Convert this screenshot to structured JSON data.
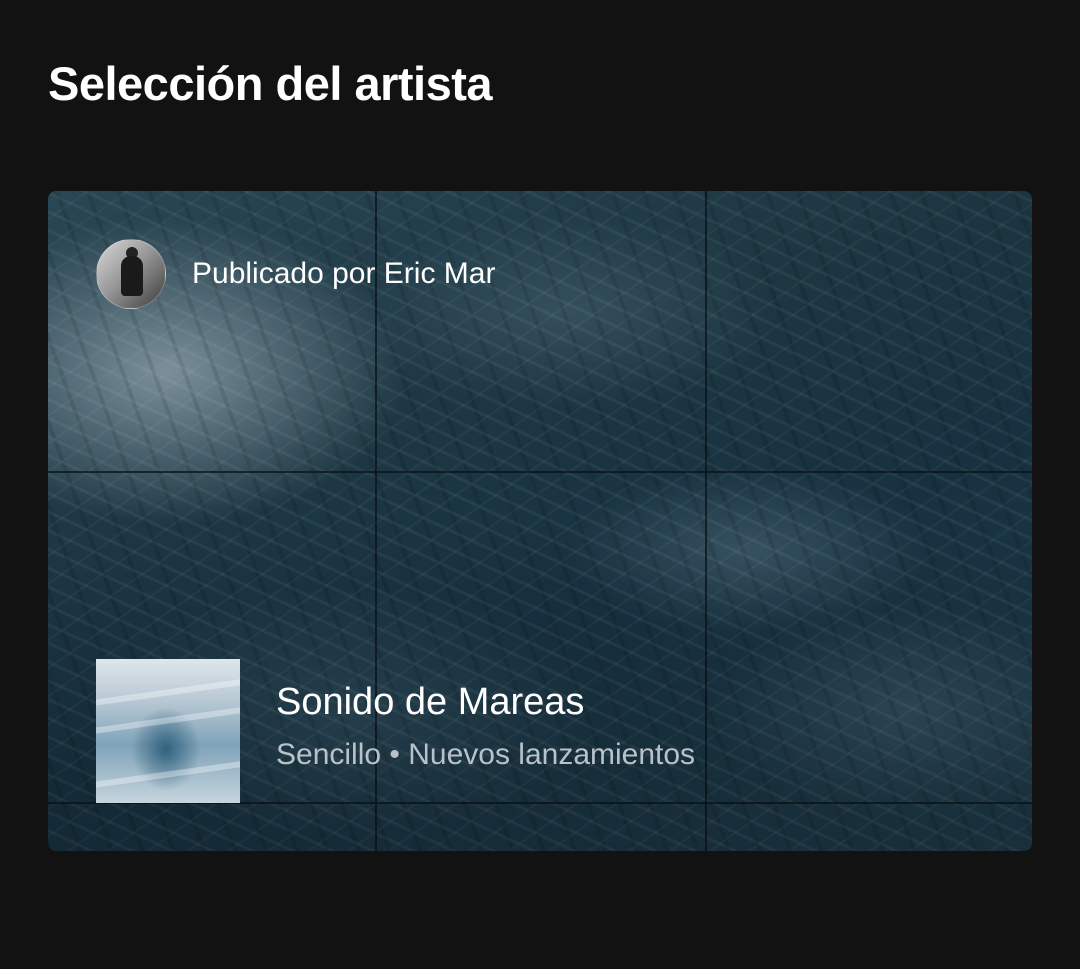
{
  "section": {
    "title": "Selección del artista"
  },
  "card": {
    "publisher": "Publicado por Eric Mar",
    "release": {
      "title": "Sonido de Mareas",
      "type": "Sencillo",
      "separator": "•",
      "tag": "Nuevos lanzamientos",
      "meta": "Sencillo • Nuevos lanzamientos"
    }
  },
  "colors": {
    "background": "#121212",
    "text_primary": "#ffffff",
    "text_secondary": "#b8c2c8"
  }
}
